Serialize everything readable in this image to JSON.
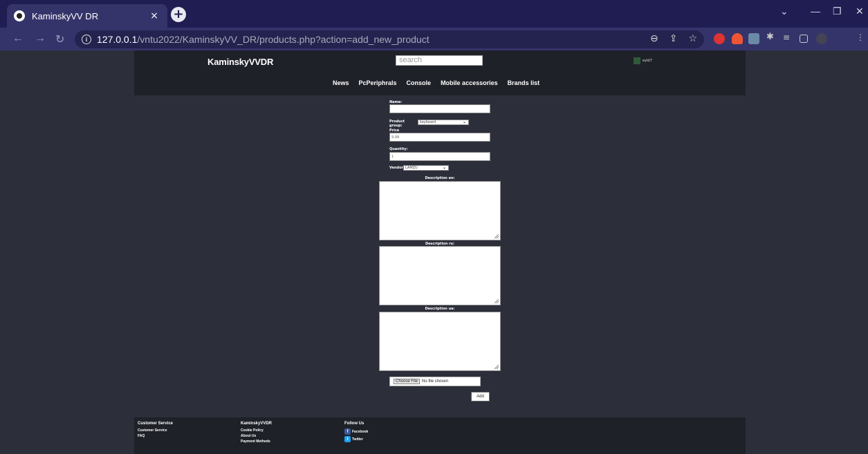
{
  "browser": {
    "tab_title": "KaminskyVV DR",
    "tab_close": "×",
    "new_tab": "+",
    "url_host": "127.0.0.1",
    "url_path": "/vntu2022/KaminskyVV_DR/products.php?action=add_new_product",
    "info_icon": "i"
  },
  "header": {
    "logo": "KaminskyVVDR",
    "search_placeholder": "search",
    "username": "eyld7"
  },
  "nav": {
    "items": [
      "News",
      "PcPeriphrals",
      "Console",
      "Mobile accessories",
      "Brands list"
    ]
  },
  "form": {
    "name_label": "Name:",
    "name_value": "",
    "group_label": "Product group:",
    "group_value": "keyboard",
    "price_label": "Price usd:",
    "price_value": "9.99",
    "quantity_label": "Quantity:",
    "quantity_value": "1",
    "vendor_label": "Vendor:",
    "vendor_value": "LAMZU",
    "desc_en_label": "Description en:",
    "desc_ru_label": "Description ru:",
    "desc_ua_label": "Description ua:",
    "choose_file": "Choose File",
    "no_file": "No file chosen",
    "add_button": "Add"
  },
  "footer": {
    "col1_title": "Customer Service",
    "col1_links": [
      "Customer Service",
      "FAQ"
    ],
    "col2_title": "KaminskyVVDR",
    "col2_links": [
      "Cookie Policy",
      "About Us",
      "Payment Methods"
    ],
    "col3_title": "Follow Us",
    "col3_links": [
      "Facebook",
      "Twitter"
    ]
  }
}
